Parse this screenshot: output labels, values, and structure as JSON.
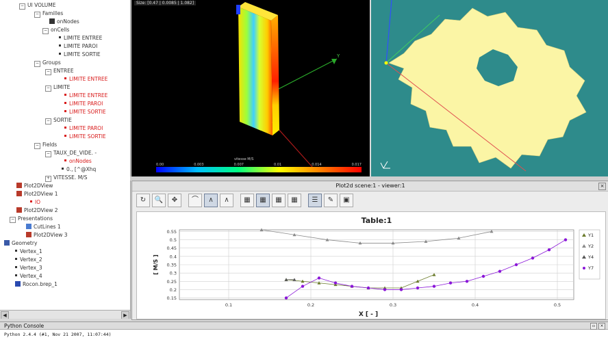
{
  "tree": {
    "items": [
      {
        "label": "UI VOLUME",
        "indent": 28,
        "icon": "toggle-minus",
        "color": "#333"
      },
      {
        "label": "Familles",
        "indent": 50,
        "icon": "toggle-minus",
        "color": "#333"
      },
      {
        "label": "onNodes",
        "indent": 72,
        "icon": "mesh-icon",
        "color": "#333"
      },
      {
        "label": "onCells",
        "indent": 62,
        "icon": "toggle-minus",
        "color": "#333"
      },
      {
        "label": "LIMITE ENTREE",
        "indent": 86,
        "icon": "bullet",
        "color": "#333"
      },
      {
        "label": "LIMITE PAROI",
        "indent": 86,
        "icon": "bullet",
        "color": "#333"
      },
      {
        "label": "LIMITE SORTIE",
        "indent": 86,
        "icon": "bullet",
        "color": "#333"
      },
      {
        "label": "Groups",
        "indent": 50,
        "icon": "toggle-minus",
        "color": "#333"
      },
      {
        "label": "ENTREE",
        "indent": 66,
        "icon": "toggle-minus",
        "color": "#333"
      },
      {
        "label": "LIMITE ENTREE",
        "indent": 94,
        "icon": "bullet",
        "color": "#d81818"
      },
      {
        "label": "LIMITE",
        "indent": 66,
        "icon": "toggle-minus",
        "color": "#333"
      },
      {
        "label": "LIMITE ENTREE",
        "indent": 94,
        "icon": "bullet",
        "color": "#d81818"
      },
      {
        "label": "LIMITE PAROI",
        "indent": 94,
        "icon": "bullet",
        "color": "#d81818"
      },
      {
        "label": "LIMITE SORTIE",
        "indent": 94,
        "icon": "bullet",
        "color": "#d81818"
      },
      {
        "label": "SORTIE",
        "indent": 66,
        "icon": "toggle-minus",
        "color": "#333"
      },
      {
        "label": "LIMITE PAROI",
        "indent": 94,
        "icon": "bullet",
        "color": "#d81818"
      },
      {
        "label": "LIMITE SORTIE",
        "indent": 94,
        "icon": "bullet",
        "color": "#d81818"
      },
      {
        "label": "Fields",
        "indent": 50,
        "icon": "toggle-minus",
        "color": "#333"
      },
      {
        "label": "TAUX_DE_VIDE. -",
        "indent": 66,
        "icon": "toggle-minus",
        "color": "#333"
      },
      {
        "label": "onNodes",
        "indent": 94,
        "icon": "bullet",
        "color": "#d81818"
      },
      {
        "label": "0., [^@Xhq",
        "indent": 90,
        "icon": "bullet",
        "color": "#333"
      },
      {
        "label": "VITESSE. M/S",
        "indent": 66,
        "icon": "toggle-plus",
        "color": "#333"
      },
      {
        "label": "Plot2DView",
        "indent": 24,
        "icon": "chart-icon",
        "color": "#333"
      },
      {
        "label": "Plot2DView 1",
        "indent": 24,
        "icon": "chart-icon",
        "color": "#333"
      },
      {
        "label": "lO",
        "indent": 44,
        "icon": "bullet",
        "color": "#d81818"
      },
      {
        "label": "Plot2DView 2",
        "indent": 24,
        "icon": "chart-icon",
        "color": "#333"
      },
      {
        "label": "Presentations",
        "indent": 14,
        "icon": "toggle-minus",
        "color": "#333"
      },
      {
        "label": "CutLines 1",
        "indent": 38,
        "icon": "cutlines-icon",
        "color": "#333"
      },
      {
        "label": "Plot2DView 3",
        "indent": 38,
        "icon": "chart-icon",
        "color": "#333"
      },
      {
        "label": "Geometry",
        "indent": 6,
        "icon": "geometry-icon",
        "color": "#333"
      },
      {
        "label": "Vertex_1",
        "indent": 22,
        "icon": "bullet",
        "color": "#333"
      },
      {
        "label": "Vertex_2",
        "indent": 22,
        "icon": "bullet",
        "color": "#333"
      },
      {
        "label": "Vertex_3",
        "indent": 22,
        "icon": "bullet",
        "color": "#333"
      },
      {
        "label": "Vertex_4",
        "indent": 22,
        "icon": "bullet",
        "color": "#333"
      },
      {
        "label": "Rocon.brep_1",
        "indent": 22,
        "icon": "shape-icon",
        "color": "#333"
      }
    ],
    "scroll_left": "◀",
    "scroll_right": "▶"
  },
  "view3d": {
    "info": "Size: [0.47 | 0.0085 | 1.082]",
    "colorbar_title": "vitesse  M/S",
    "colorbar_ticks": [
      "0.00",
      "0.003",
      "0.007",
      "0.01",
      "0.014",
      "0.017"
    ]
  },
  "plot": {
    "window_title": "Plot2d scene:1 - viewer:1",
    "close": "×",
    "toolbar": [
      "↻",
      "🔍",
      "✥",
      "⌒",
      "∧",
      "∧",
      "▦",
      "▦",
      "▦",
      "▦",
      "☰",
      "✎",
      "▣"
    ],
    "legend": [
      "Y1",
      "Y2",
      "Y4",
      "Y7"
    ]
  },
  "chart_data": {
    "type": "scatter",
    "title": "Table:1",
    "xlabel": "X [ - ]",
    "ylabel": "[ M/S ]",
    "xlim": [
      0.04,
      0.52
    ],
    "ylim": [
      0.14,
      0.56
    ],
    "x_ticks": [
      "0.1",
      "0.2",
      "0.3",
      "0.4",
      "0.5"
    ],
    "y_ticks": [
      "0.15",
      "0.2",
      "0.25",
      "0.3",
      "0.35",
      "0.4",
      "0.45",
      "0.5",
      "0.55"
    ],
    "grid": true,
    "legend_position": "right",
    "series": [
      {
        "name": "Y1",
        "color": "#6a7a2a",
        "marker": "triangle",
        "x": [
          0.17,
          0.19,
          0.21,
          0.23,
          0.25,
          0.27,
          0.29,
          0.31,
          0.33,
          0.35
        ],
        "y": [
          0.26,
          0.25,
          0.24,
          0.23,
          0.22,
          0.21,
          0.21,
          0.21,
          0.25,
          0.29
        ]
      },
      {
        "name": "Y2",
        "color": "#8a8a8a",
        "marker": "triangle",
        "x": [
          0.14,
          0.18,
          0.22,
          0.26,
          0.3,
          0.34,
          0.38,
          0.42
        ],
        "y": [
          0.56,
          0.53,
          0.5,
          0.48,
          0.48,
          0.49,
          0.51,
          0.55
        ]
      },
      {
        "name": "Y4",
        "color": "#555555",
        "marker": "triangle",
        "x": [
          0.17,
          0.18
        ],
        "y": [
          0.26,
          0.26
        ]
      },
      {
        "name": "Y7",
        "color": "#8a16d8",
        "marker": "circle",
        "x": [
          0.17,
          0.19,
          0.21,
          0.23,
          0.25,
          0.27,
          0.29,
          0.31,
          0.33,
          0.35,
          0.37,
          0.39,
          0.41,
          0.43,
          0.45,
          0.47,
          0.49,
          0.51
        ],
        "y": [
          0.15,
          0.22,
          0.27,
          0.24,
          0.22,
          0.21,
          0.2,
          0.2,
          0.21,
          0.22,
          0.24,
          0.25,
          0.28,
          0.31,
          0.35,
          0.39,
          0.44,
          0.5
        ]
      }
    ]
  },
  "console": {
    "title": "Python Console",
    "text": "Python 2.4.4 (#1, Nov 21 2007, 11:07:44)"
  }
}
